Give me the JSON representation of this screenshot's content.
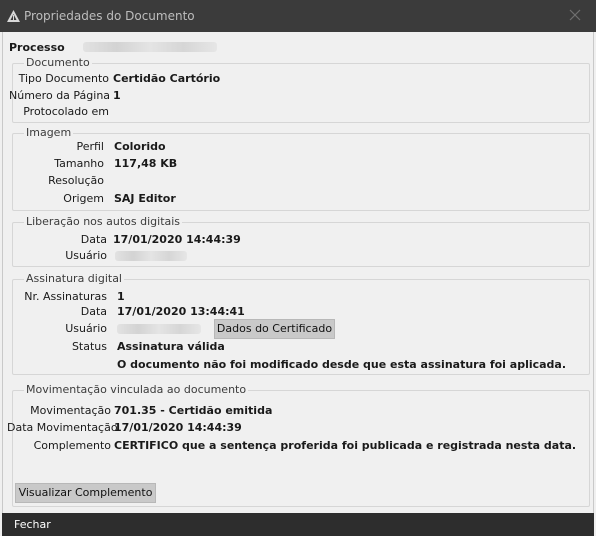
{
  "window": {
    "title": "Propriedades do Documento"
  },
  "processo": {
    "label": "Processo"
  },
  "documento": {
    "legend": "Documento",
    "tipo_label": "Tipo Documento",
    "tipo_value": "Certidão Cartório",
    "pagina_label": "Número da Página",
    "pagina_value": "1",
    "protocolado_label": "Protocolado em",
    "protocolado_value": ""
  },
  "imagem": {
    "legend": "Imagem",
    "perfil_label": "Perfil",
    "perfil_value": "Colorido",
    "tamanho_label": "Tamanho",
    "tamanho_value": "117,48 KB",
    "resolucao_label": "Resolução",
    "resolucao_value": "",
    "origem_label": "Origem",
    "origem_value": "SAJ Editor"
  },
  "liberacao": {
    "legend": "Liberação nos autos digitais",
    "data_label": "Data",
    "data_value": "17/01/2020 14:44:39",
    "usuario_label": "Usuário"
  },
  "assinatura": {
    "legend": "Assinatura digital",
    "nr_label": "Nr. Assinaturas",
    "nr_value": "1",
    "data_label": "Data",
    "data_value": "17/01/2020 13:44:41",
    "usuario_label": "Usuário",
    "certificado_button": "Dados do Certificado",
    "status_label": "Status",
    "status_value": "Assinatura válida",
    "status_message": "O documento não foi modificado desde que esta assinatura foi aplicada."
  },
  "movimentacao": {
    "legend": "Movimentação vinculada ao documento",
    "mov_label": "Movimentação",
    "mov_value": "701.35 - Certidão emitida",
    "data_label": "Data Movimentação",
    "data_value": "17/01/2020 14:44:39",
    "complemento_label": "Complemento",
    "complemento_value": "CERTIFICO que a sentença proferida foi publicada e registrada nesta data.",
    "visualizar_button": "Visualizar Complemento"
  },
  "footer": {
    "fechar_label": "Fechar"
  },
  "colors": {
    "titlebar": "#3b3b3b",
    "footer": "#2d2d2d",
    "button": "#c9c9c9"
  }
}
